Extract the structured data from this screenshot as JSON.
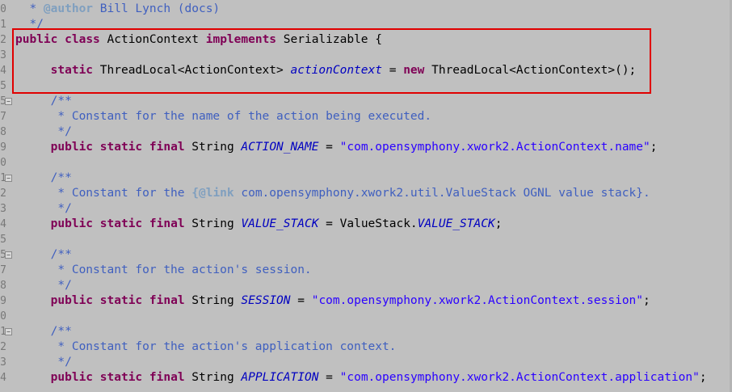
{
  "lines": [
    {
      "n": "0",
      "fold": false,
      "tokens": [
        [
          "cm",
          "  * "
        ],
        [
          "tag",
          "@author"
        ],
        [
          "cm",
          " Bill Lynch (docs)"
        ]
      ]
    },
    {
      "n": "1",
      "fold": false,
      "tokens": [
        [
          "cm",
          "  */"
        ]
      ]
    },
    {
      "n": "2",
      "fold": false,
      "tokens": [
        [
          "kw",
          "public"
        ],
        [
          "pl",
          " "
        ],
        [
          "kw",
          "class"
        ],
        [
          "pl",
          " ActionContext "
        ],
        [
          "kw",
          "implements"
        ],
        [
          "pl",
          " Serializable {"
        ]
      ]
    },
    {
      "n": "3",
      "fold": false,
      "tokens": []
    },
    {
      "n": "4",
      "fold": false,
      "tokens": [
        [
          "pl",
          "     "
        ],
        [
          "kw",
          "static"
        ],
        [
          "pl",
          " ThreadLocal<ActionContext> "
        ],
        [
          "fld",
          "actionContext"
        ],
        [
          "pl",
          " = "
        ],
        [
          "kw",
          "new"
        ],
        [
          "pl",
          " ThreadLocal<ActionContext>();"
        ]
      ]
    },
    {
      "n": "5",
      "fold": false,
      "tokens": []
    },
    {
      "n": "5",
      "fold": true,
      "tokens": [
        [
          "pl",
          "     "
        ],
        [
          "cm",
          "/**"
        ]
      ]
    },
    {
      "n": "7",
      "fold": false,
      "tokens": [
        [
          "cm",
          "      * Constant for the name of the action being executed."
        ]
      ]
    },
    {
      "n": "8",
      "fold": false,
      "tokens": [
        [
          "cm",
          "      */"
        ]
      ]
    },
    {
      "n": "9",
      "fold": false,
      "tokens": [
        [
          "pl",
          "     "
        ],
        [
          "kw",
          "public"
        ],
        [
          "pl",
          " "
        ],
        [
          "kw",
          "static"
        ],
        [
          "pl",
          " "
        ],
        [
          "kw",
          "final"
        ],
        [
          "pl",
          " String "
        ],
        [
          "fld",
          "ACTION_NAME"
        ],
        [
          "pl",
          " = "
        ],
        [
          "str",
          "\"com.opensymphony.xwork2.ActionContext.name\""
        ],
        [
          "pl",
          ";"
        ]
      ]
    },
    {
      "n": "0",
      "fold": false,
      "tokens": []
    },
    {
      "n": "1",
      "fold": true,
      "tokens": [
        [
          "pl",
          "     "
        ],
        [
          "cm",
          "/**"
        ]
      ]
    },
    {
      "n": "2",
      "fold": false,
      "tokens": [
        [
          "cm",
          "      * Constant for the "
        ],
        [
          "tag",
          "{@link"
        ],
        [
          "cm",
          " com.opensymphony.xwork2.util.ValueStack OGNL value stack}."
        ]
      ]
    },
    {
      "n": "3",
      "fold": false,
      "tokens": [
        [
          "cm",
          "      */"
        ]
      ]
    },
    {
      "n": "4",
      "fold": false,
      "tokens": [
        [
          "pl",
          "     "
        ],
        [
          "kw",
          "public"
        ],
        [
          "pl",
          " "
        ],
        [
          "kw",
          "static"
        ],
        [
          "pl",
          " "
        ],
        [
          "kw",
          "final"
        ],
        [
          "pl",
          " String "
        ],
        [
          "fld",
          "VALUE_STACK"
        ],
        [
          "pl",
          " = ValueStack."
        ],
        [
          "fld",
          "VALUE_STACK"
        ],
        [
          "pl",
          ";"
        ]
      ]
    },
    {
      "n": "5",
      "fold": false,
      "tokens": []
    },
    {
      "n": "5",
      "fold": true,
      "tokens": [
        [
          "pl",
          "     "
        ],
        [
          "cm",
          "/**"
        ]
      ]
    },
    {
      "n": "7",
      "fold": false,
      "tokens": [
        [
          "cm",
          "      * Constant for the action's session."
        ]
      ]
    },
    {
      "n": "8",
      "fold": false,
      "tokens": [
        [
          "cm",
          "      */"
        ]
      ]
    },
    {
      "n": "9",
      "fold": false,
      "tokens": [
        [
          "pl",
          "     "
        ],
        [
          "kw",
          "public"
        ],
        [
          "pl",
          " "
        ],
        [
          "kw",
          "static"
        ],
        [
          "pl",
          " "
        ],
        [
          "kw",
          "final"
        ],
        [
          "pl",
          " String "
        ],
        [
          "fld",
          "SESSION"
        ],
        [
          "pl",
          " = "
        ],
        [
          "str",
          "\"com.opensymphony.xwork2.ActionContext.session\""
        ],
        [
          "pl",
          ";"
        ]
      ]
    },
    {
      "n": "0",
      "fold": false,
      "tokens": []
    },
    {
      "n": "1",
      "fold": true,
      "tokens": [
        [
          "pl",
          "     "
        ],
        [
          "cm",
          "/**"
        ]
      ]
    },
    {
      "n": "2",
      "fold": false,
      "tokens": [
        [
          "cm",
          "      * Constant for the action's application context."
        ]
      ]
    },
    {
      "n": "3",
      "fold": false,
      "tokens": [
        [
          "cm",
          "      */"
        ]
      ]
    },
    {
      "n": "4",
      "fold": false,
      "tokens": [
        [
          "pl",
          "     "
        ],
        [
          "kw",
          "public"
        ],
        [
          "pl",
          " "
        ],
        [
          "kw",
          "static"
        ],
        [
          "pl",
          " "
        ],
        [
          "kw",
          "final"
        ],
        [
          "pl",
          " String "
        ],
        [
          "fld",
          "APPLICATION"
        ],
        [
          "pl",
          " = "
        ],
        [
          "str",
          "\"com.opensymphony.xwork2.ActionContext.application\""
        ],
        [
          "pl",
          ";"
        ]
      ]
    }
  ],
  "fold_glyph": "−",
  "colors": {
    "background": "#c0c0c0",
    "keyword": "#7f0055",
    "comment": "#3f5fbf",
    "javadoc_tag": "#7f9fbf",
    "field": "#0000c0",
    "string": "#2a00ff",
    "highlight_border": "#e00000"
  }
}
